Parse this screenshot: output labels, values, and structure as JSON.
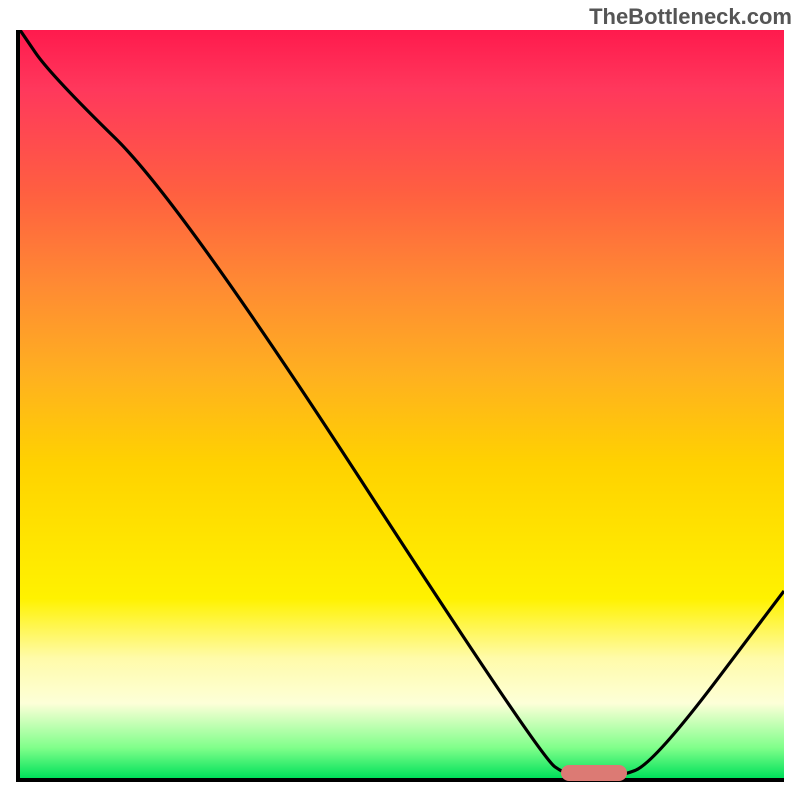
{
  "watermark": "TheBottleneck.com",
  "colors": {
    "axis": "#000000",
    "line": "#000000",
    "marker": "#dc7a74",
    "gradient_top": "#ff1a4d",
    "gradient_bottom": "#00e05a"
  },
  "chart_data": {
    "type": "line",
    "title": "",
    "xlabel": "",
    "ylabel": "",
    "x": [
      0.0,
      0.04,
      0.21,
      0.68,
      0.72,
      0.78,
      0.83,
      1.0
    ],
    "values": [
      1.0,
      0.94,
      0.77,
      0.03,
      0.0,
      0.0,
      0.02,
      0.25
    ],
    "xlim": [
      0,
      1
    ],
    "ylim": [
      0,
      1
    ],
    "marker": {
      "x_start": 0.705,
      "x_end": 0.79,
      "y": 0.012
    },
    "annotations": []
  }
}
